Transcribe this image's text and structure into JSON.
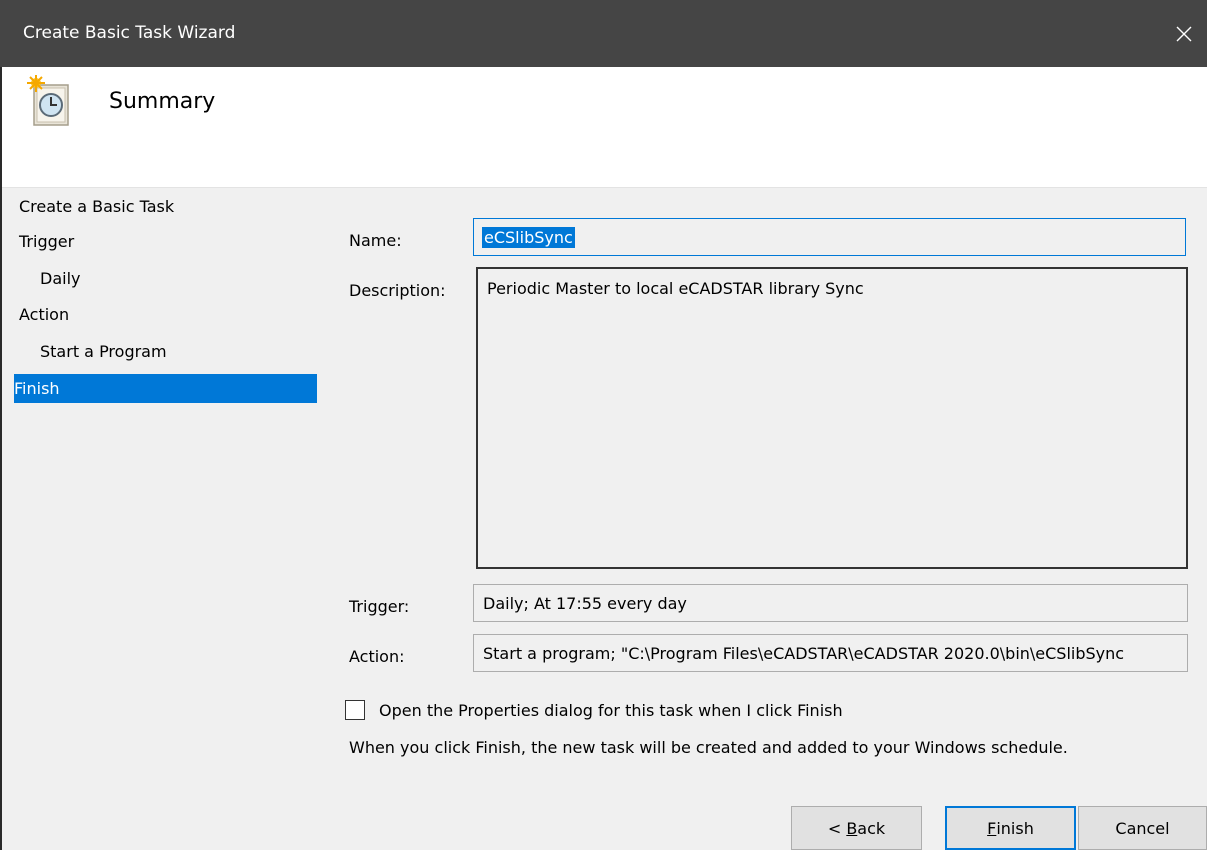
{
  "window": {
    "title": "Create Basic Task Wizard",
    "close_glyph": "✕"
  },
  "header": {
    "title": "Summary",
    "icon": "task-clock-icon"
  },
  "nav": {
    "steps": [
      {
        "label": "Create a Basic Task"
      },
      {
        "label": "Trigger"
      },
      {
        "label": "Daily"
      },
      {
        "label": "Action"
      },
      {
        "label": "Start a Program"
      },
      {
        "label": "Finish"
      }
    ],
    "active": "Finish"
  },
  "form": {
    "name_label": "Name:",
    "name_value": "eCSlibSync",
    "description_label": "Description:",
    "description_value": "Periodic Master to local eCADSTAR library Sync",
    "trigger_label": "Trigger:",
    "trigger_value": "Daily; At 17:55 every day",
    "action_label": "Action:",
    "action_value": "Start a program; \"C:\\Program Files\\eCADSTAR\\eCADSTAR 2020.0\\bin\\eCSlibSync"
  },
  "options": {
    "open_properties_label": "Open the Properties dialog for this task when I click Finish",
    "open_properties_checked": false,
    "info_text": "When you click Finish, the new task will be created and added to your Windows schedule."
  },
  "buttons": {
    "back_prefix": "< ",
    "back_mnemonic": "B",
    "back_rest": "ack",
    "finish_mnemonic": "F",
    "finish_rest": "inish",
    "cancel": "Cancel"
  },
  "colors": {
    "accent": "#0078d7",
    "titlebar": "#454545",
    "background": "#f0f0f0"
  }
}
